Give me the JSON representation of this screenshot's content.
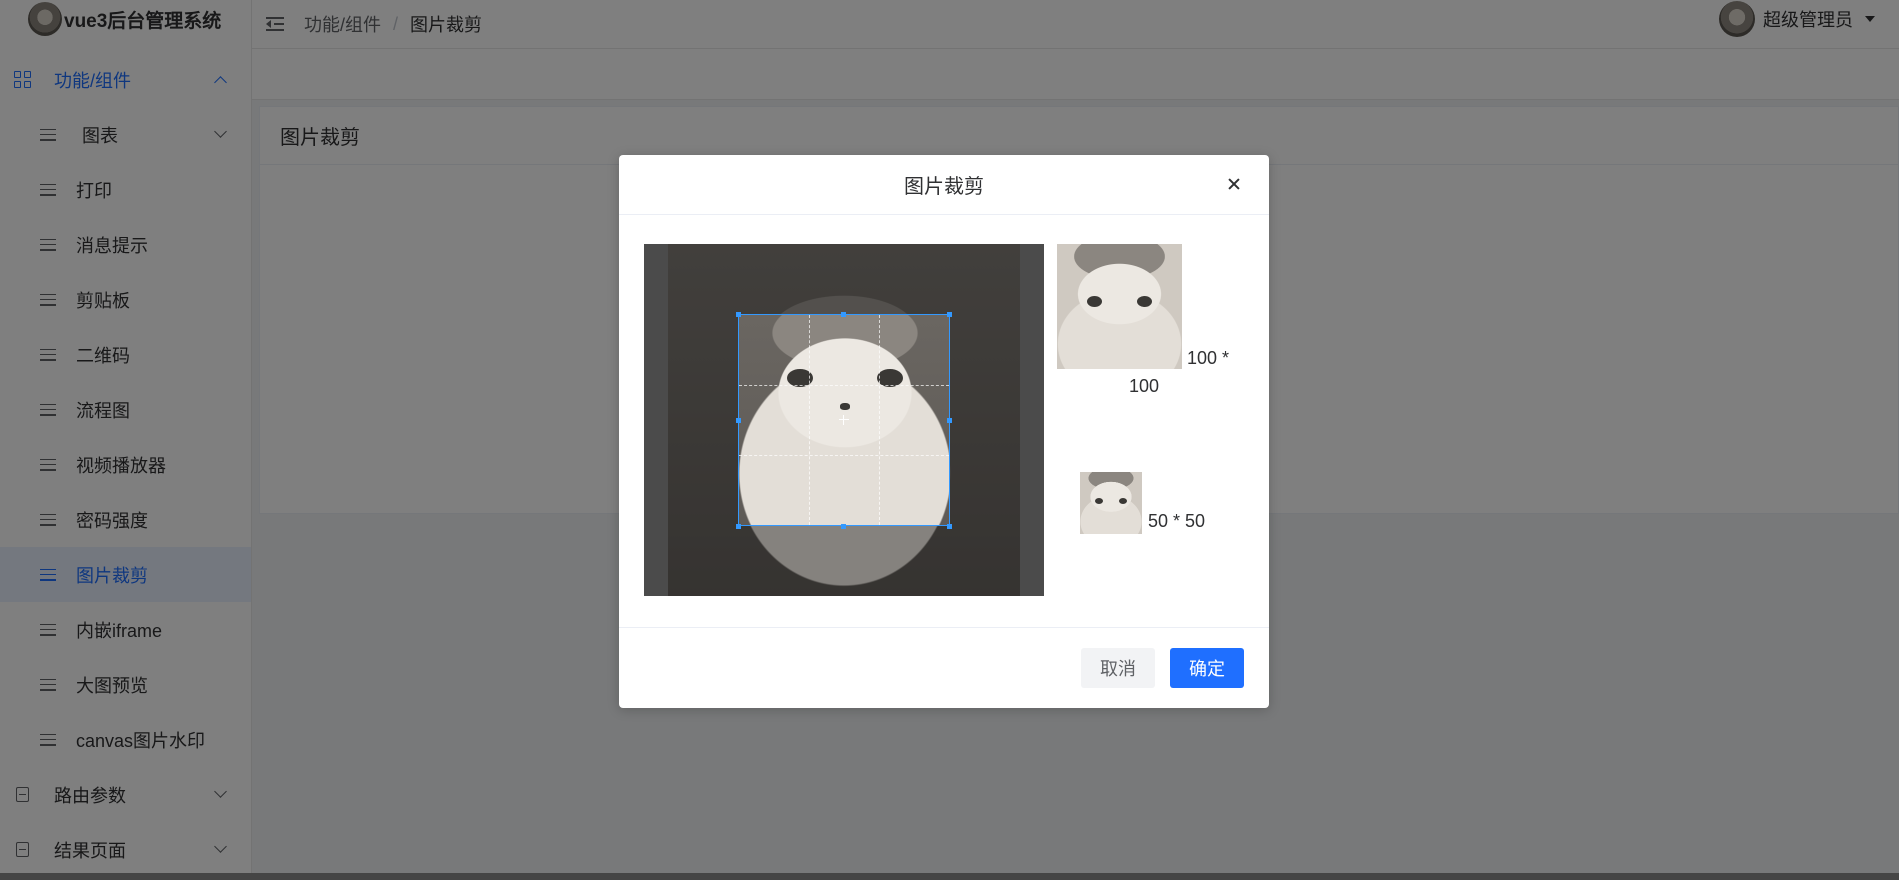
{
  "app": {
    "title": "vue3后台管理系统"
  },
  "header": {
    "breadcrumb": [
      "功能/组件",
      "图片裁剪"
    ],
    "breadcrumb_sep": "/",
    "user": {
      "name": "超级管理员"
    }
  },
  "sidebar": {
    "parent": {
      "label": "功能/组件",
      "icon": "grid-icon",
      "expanded": true
    },
    "items": [
      {
        "label": "图表",
        "icon": "menu-lines-icon",
        "has_children": true
      },
      {
        "label": "打印",
        "icon": "menu-lines-icon"
      },
      {
        "label": "消息提示",
        "icon": "menu-lines-icon"
      },
      {
        "label": "剪贴板",
        "icon": "menu-lines-icon"
      },
      {
        "label": "二维码",
        "icon": "menu-lines-icon"
      },
      {
        "label": "流程图",
        "icon": "menu-lines-icon"
      },
      {
        "label": "视频播放器",
        "icon": "menu-lines-icon"
      },
      {
        "label": "密码强度",
        "icon": "menu-lines-icon"
      },
      {
        "label": "图片裁剪",
        "icon": "menu-lines-icon",
        "active": true
      },
      {
        "label": "内嵌iframe",
        "icon": "menu-lines-icon"
      },
      {
        "label": "大图预览",
        "icon": "menu-lines-icon"
      },
      {
        "label": "canvas图片水印",
        "icon": "menu-lines-icon"
      }
    ],
    "roots": [
      {
        "label": "路由参数",
        "icon": "document-icon"
      },
      {
        "label": "结果页面",
        "icon": "document-icon"
      }
    ]
  },
  "main": {
    "card_title": "图片裁剪"
  },
  "dialog": {
    "title": "图片裁剪",
    "preview_large_label_line1": "100 *",
    "preview_large_label_line2": "100",
    "preview_small_label": "50 * 50",
    "cancel_label": "取消",
    "confirm_label": "确定"
  },
  "colors": {
    "accent": "#1f6fff",
    "overlay": "rgba(0,0,0,0.5)",
    "crop_border": "#3399ff"
  }
}
